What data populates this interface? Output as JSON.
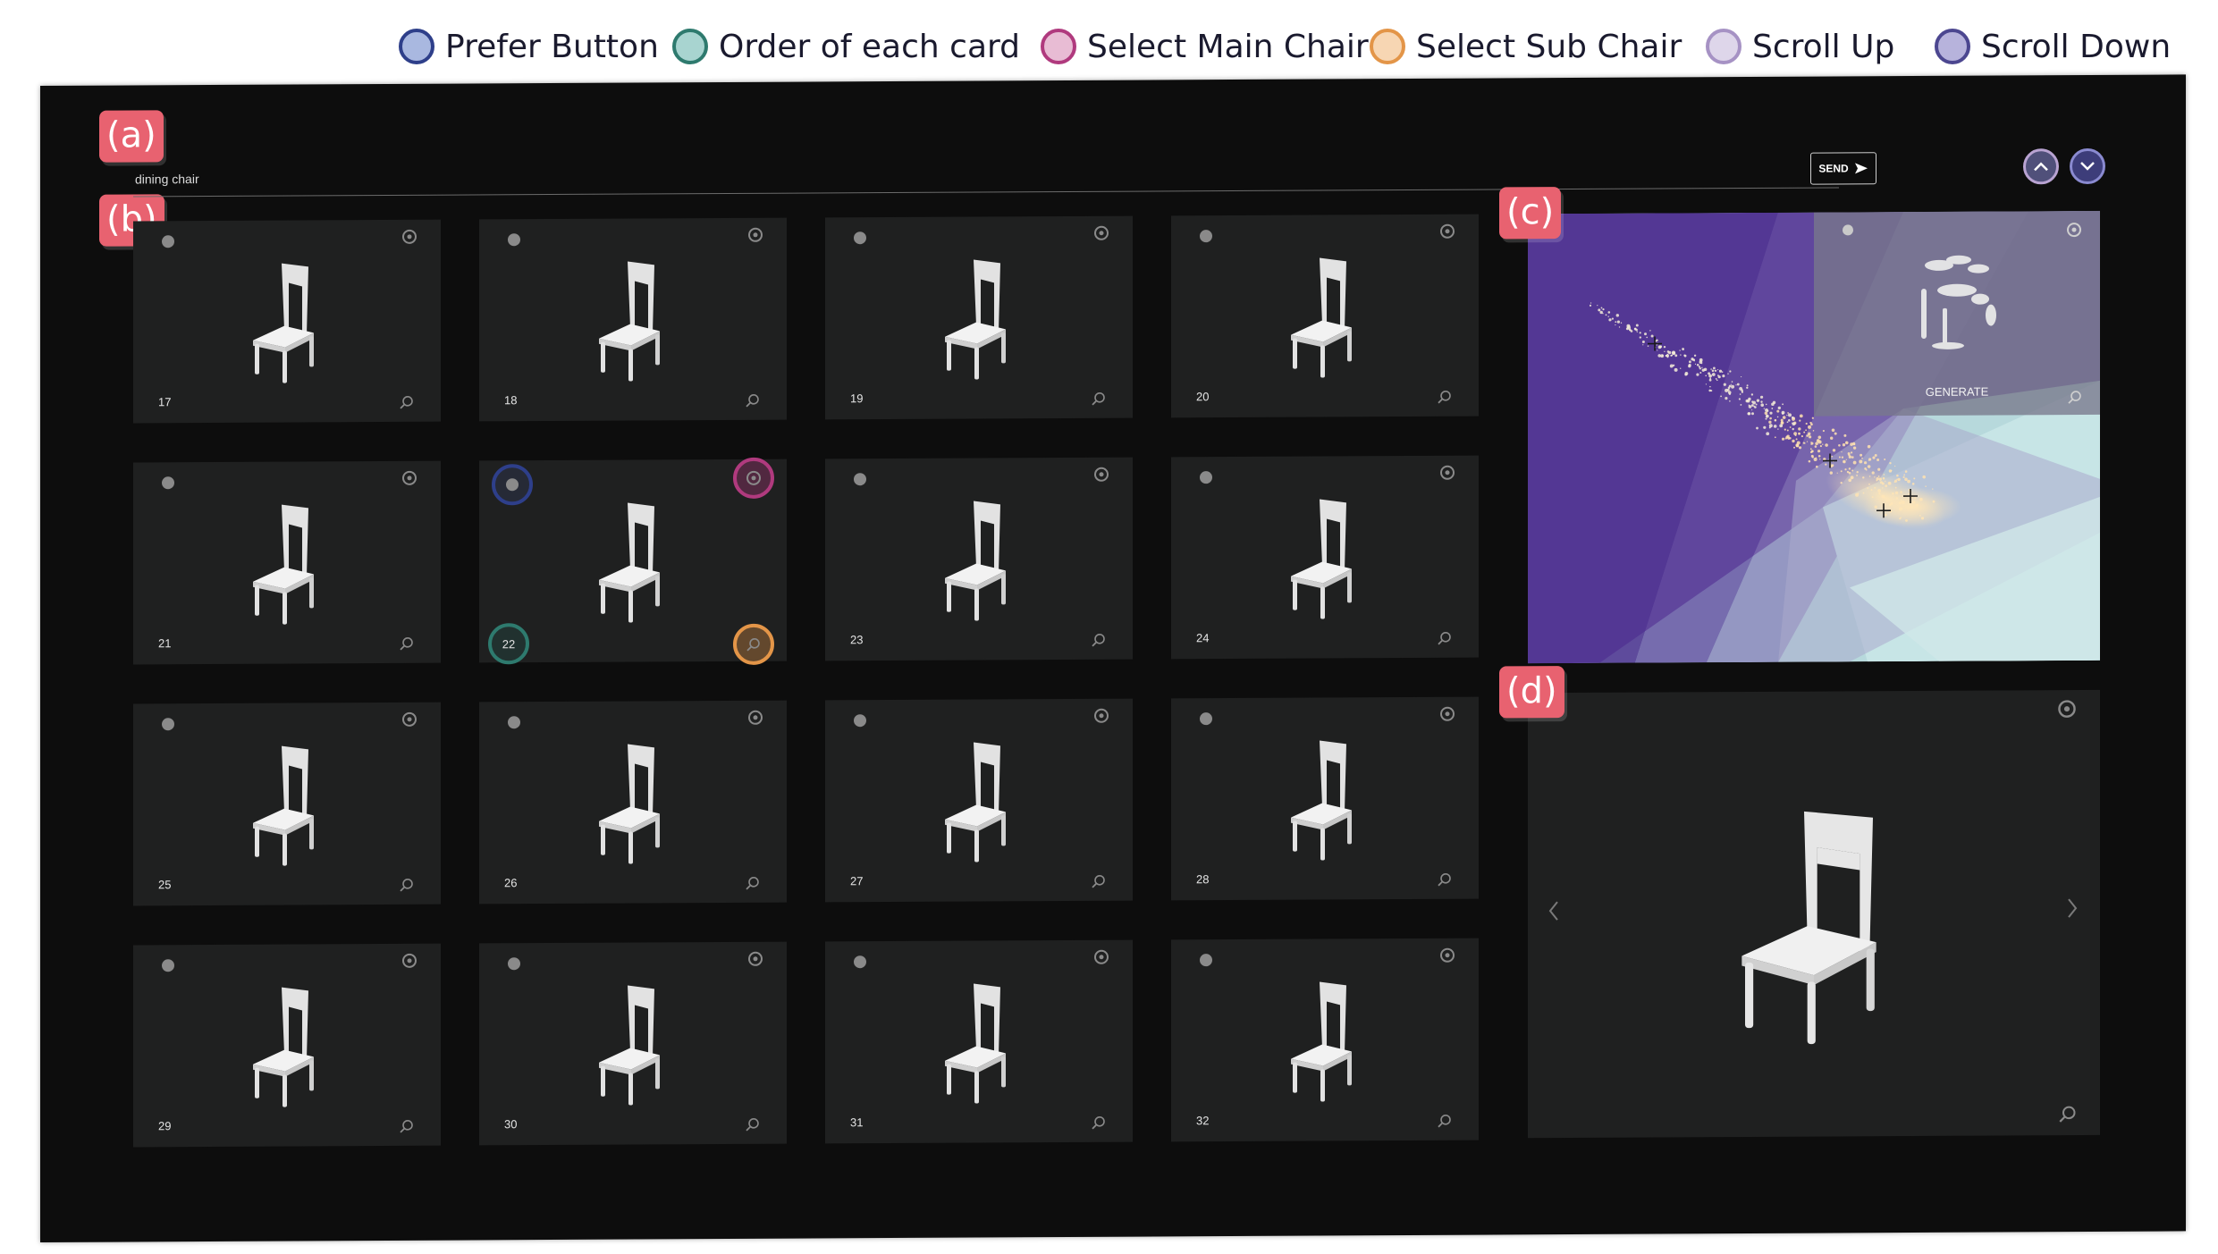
{
  "legend": [
    {
      "label": "Prefer Button",
      "fill": "#a9b8e0",
      "stroke": "#2e3f8a"
    },
    {
      "label": "Order of each card",
      "fill": "#a8d4d0",
      "stroke": "#2e7a6e"
    },
    {
      "label": "Select Main Chair",
      "fill": "#e8bcd4",
      "stroke": "#b03a7e"
    },
    {
      "label": "Select Sub Chair",
      "fill": "#f7d6b3",
      "stroke": "#e39548"
    },
    {
      "label": "Scroll Up",
      "fill": "#ded6ea",
      "stroke": "#a692c4"
    },
    {
      "label": "Scroll Down",
      "fill": "#b7b3dc",
      "stroke": "#4c4790"
    }
  ],
  "tags": {
    "a": "(a)",
    "b": "(b)",
    "c": "(c)",
    "d": "(d)"
  },
  "search": {
    "value": "dining chair"
  },
  "send_label": "SEND",
  "cards": [
    "17",
    "18",
    "19",
    "20",
    "21",
    "22",
    "23",
    "24",
    "25",
    "26",
    "27",
    "28",
    "29",
    "30",
    "31",
    "32"
  ],
  "highlighted_card": "22",
  "map_panel": {
    "generate_label": "GENERATE"
  },
  "colors": {
    "accent_tag": "#e86270",
    "card_bg": "#1f2020",
    "app_bg": "#0d0d0d"
  }
}
